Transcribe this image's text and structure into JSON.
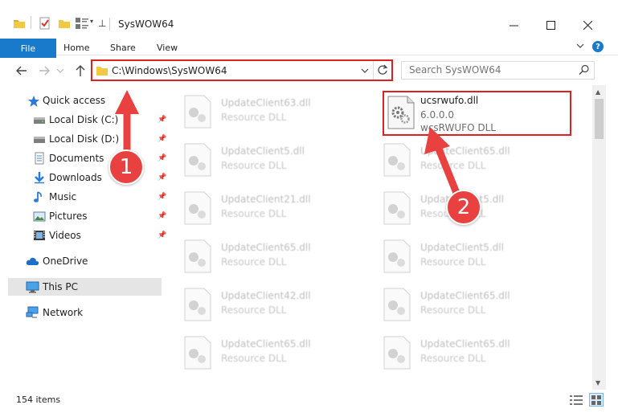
{
  "window": {
    "title": "SysWOW64",
    "minimize_icon": "minimize-icon",
    "maximize_icon": "maximize-icon",
    "close_icon": "close-icon"
  },
  "ribbon": {
    "tabs": [
      "File",
      "Home",
      "Share",
      "View"
    ],
    "help_label": "?"
  },
  "address": {
    "path": "C:\\Windows\\SysWOW64",
    "search_placeholder": "Search SysWOW64"
  },
  "sidebar": {
    "items": [
      {
        "label": "Quick access",
        "icon": "star-icon",
        "pinned": false
      },
      {
        "label": "Local Disk (C:)",
        "icon": "drive-icon",
        "pinned": true
      },
      {
        "label": "Local Disk (D:)",
        "icon": "drive-icon",
        "pinned": true
      },
      {
        "label": "Documents",
        "icon": "documents-icon",
        "pinned": true
      },
      {
        "label": "Downloads",
        "icon": "downloads-icon",
        "pinned": true
      },
      {
        "label": "Music",
        "icon": "music-icon",
        "pinned": true
      },
      {
        "label": "Pictures",
        "icon": "pictures-icon",
        "pinned": true
      },
      {
        "label": "Videos",
        "icon": "videos-icon",
        "pinned": true
      },
      {
        "label": "OneDrive",
        "icon": "cloud-icon",
        "pinned": false
      },
      {
        "label": "This PC",
        "icon": "computer-icon",
        "pinned": false,
        "selected": true
      },
      {
        "label": "Network",
        "icon": "network-icon",
        "pinned": false
      }
    ]
  },
  "files": {
    "left_column": [
      {
        "name": "UpdateClient63.dll",
        "desc": "Resource DLL"
      },
      {
        "name": "UpdateClient5.dll",
        "desc": "Resource DLL"
      },
      {
        "name": "UpdateClient21.dll",
        "desc": "Resource DLL"
      },
      {
        "name": "UpdateClient65.dll",
        "desc": "Resource DLL"
      },
      {
        "name": "UpdateClient42.dll",
        "desc": "Resource DLL"
      },
      {
        "name": "UpdateClient65.dll",
        "desc": "Resource DLL"
      }
    ],
    "right_column": [
      {
        "name": "UpdateClient65.dll",
        "desc": "Resource DLL"
      },
      {
        "name": "UpdateClient5.dll",
        "desc": "Resource DLL"
      },
      {
        "name": "UpdateClient5.dll",
        "desc": "Resource DLL"
      },
      {
        "name": "UpdateClient65.dll",
        "desc": "Resource DLL"
      },
      {
        "name": "UpdateClient65.dll",
        "desc": "Resource DLL"
      }
    ],
    "highlighted": {
      "name": "ucsrwufo.dll",
      "version": "6.0.0.0",
      "desc": "wcsRWUFO DLL"
    }
  },
  "status": {
    "item_count": "154 items"
  },
  "annotations": {
    "step1": "1",
    "step2": "2",
    "color": "#e8413f"
  }
}
